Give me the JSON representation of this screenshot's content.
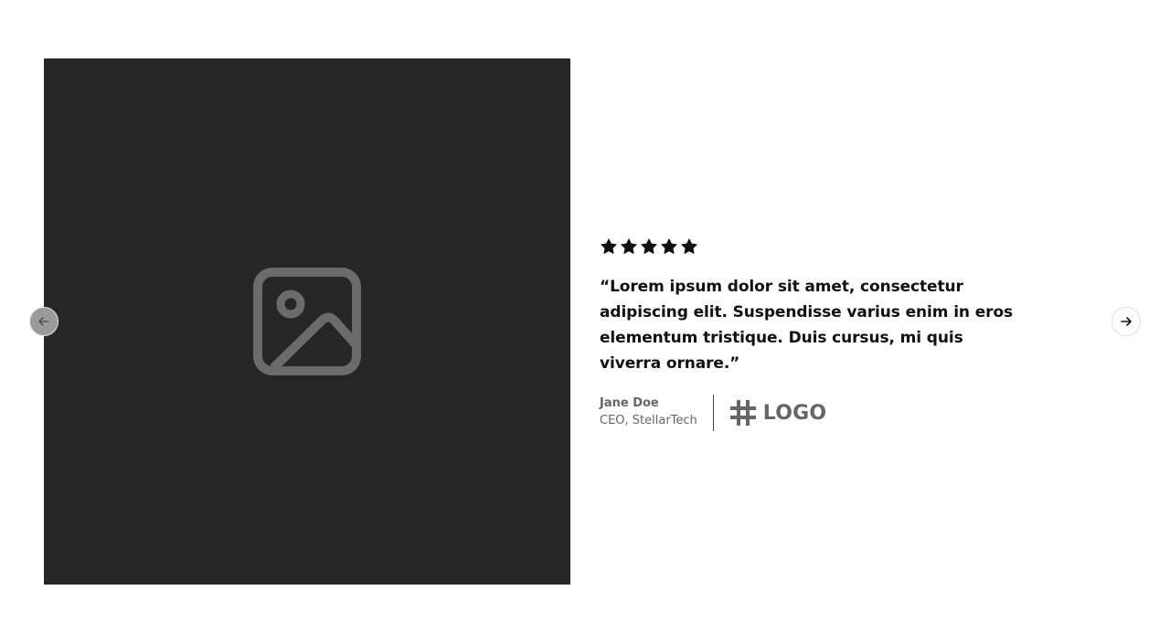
{
  "media": {
    "icon": "image-placeholder-icon",
    "background": "#262626"
  },
  "testimonial": {
    "rating": 5,
    "quote": "“Lorem ipsum dolor sit amet, consectetur adipiscing elit. Suspendisse varius enim in eros elementum tristique. Duis cursus, mi quis viverra ornare.”",
    "author_name": "Jane Doe",
    "author_role": "CEO, StellarTech",
    "logo_icon": "hash-icon",
    "logo_text": "LOGO"
  },
  "navigation": {
    "prev_icon": "arrow-left-icon",
    "next_icon": "arrow-right-icon"
  }
}
